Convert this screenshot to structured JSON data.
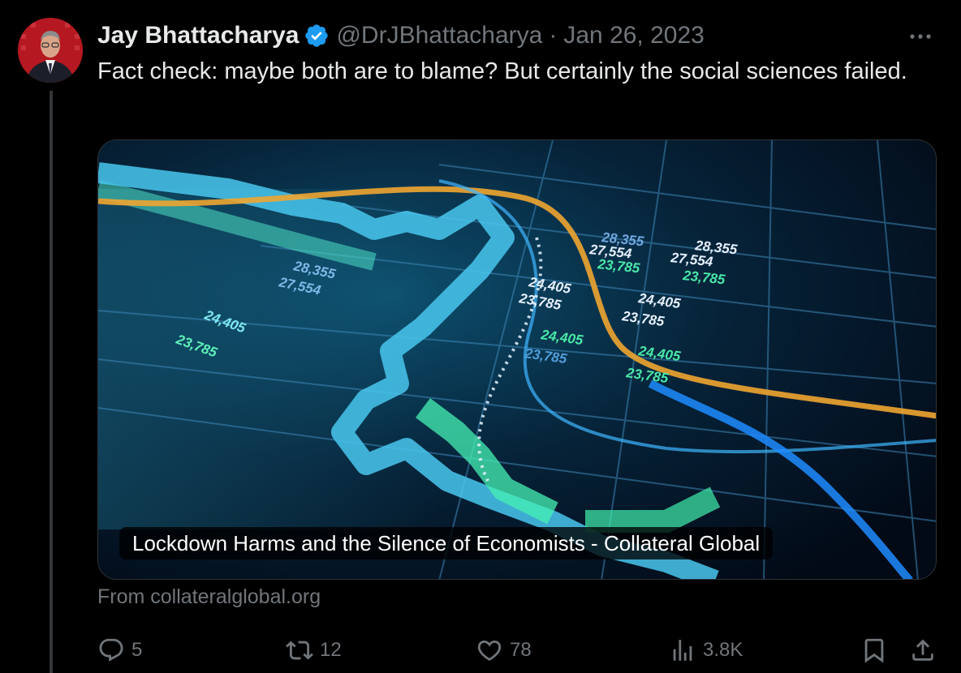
{
  "tweet": {
    "author_name": "Jay Bhattacharya",
    "handle": "@DrJBhattacharya",
    "separator": "·",
    "date": "Jan 26, 2023",
    "text": "Fact check: maybe both are to blame?  But certainly the social sciences failed.",
    "more_icon": "more-horizontal-icon",
    "verified_icon": "verified-badge-icon"
  },
  "card": {
    "title": "Lockdown Harms and the Silence of Economists - Collateral Global",
    "source": "From collateralglobal.org",
    "image_labels": {
      "a1": "28,355",
      "a2": "27,554",
      "b1": "24,405",
      "b2": "23,785",
      "c1": "24,405",
      "c2": "23,785",
      "d1": "24,405",
      "d2": "23,785",
      "e1": "24,405",
      "e2": "23,785",
      "f1": "24,405",
      "f2": "23,785",
      "g1": "28,355",
      "g2": "27,554",
      "h1": "28,355",
      "h2": "27,554",
      "i1": "23,785",
      "i2": "23,785"
    }
  },
  "actions": {
    "reply_count": "5",
    "retweet_count": "12",
    "like_count": "78",
    "views_count": "3.8K"
  },
  "colors": {
    "background": "#000000",
    "text": "#e7e9ea",
    "muted": "#71767b",
    "verified": "#1d9bf0"
  }
}
